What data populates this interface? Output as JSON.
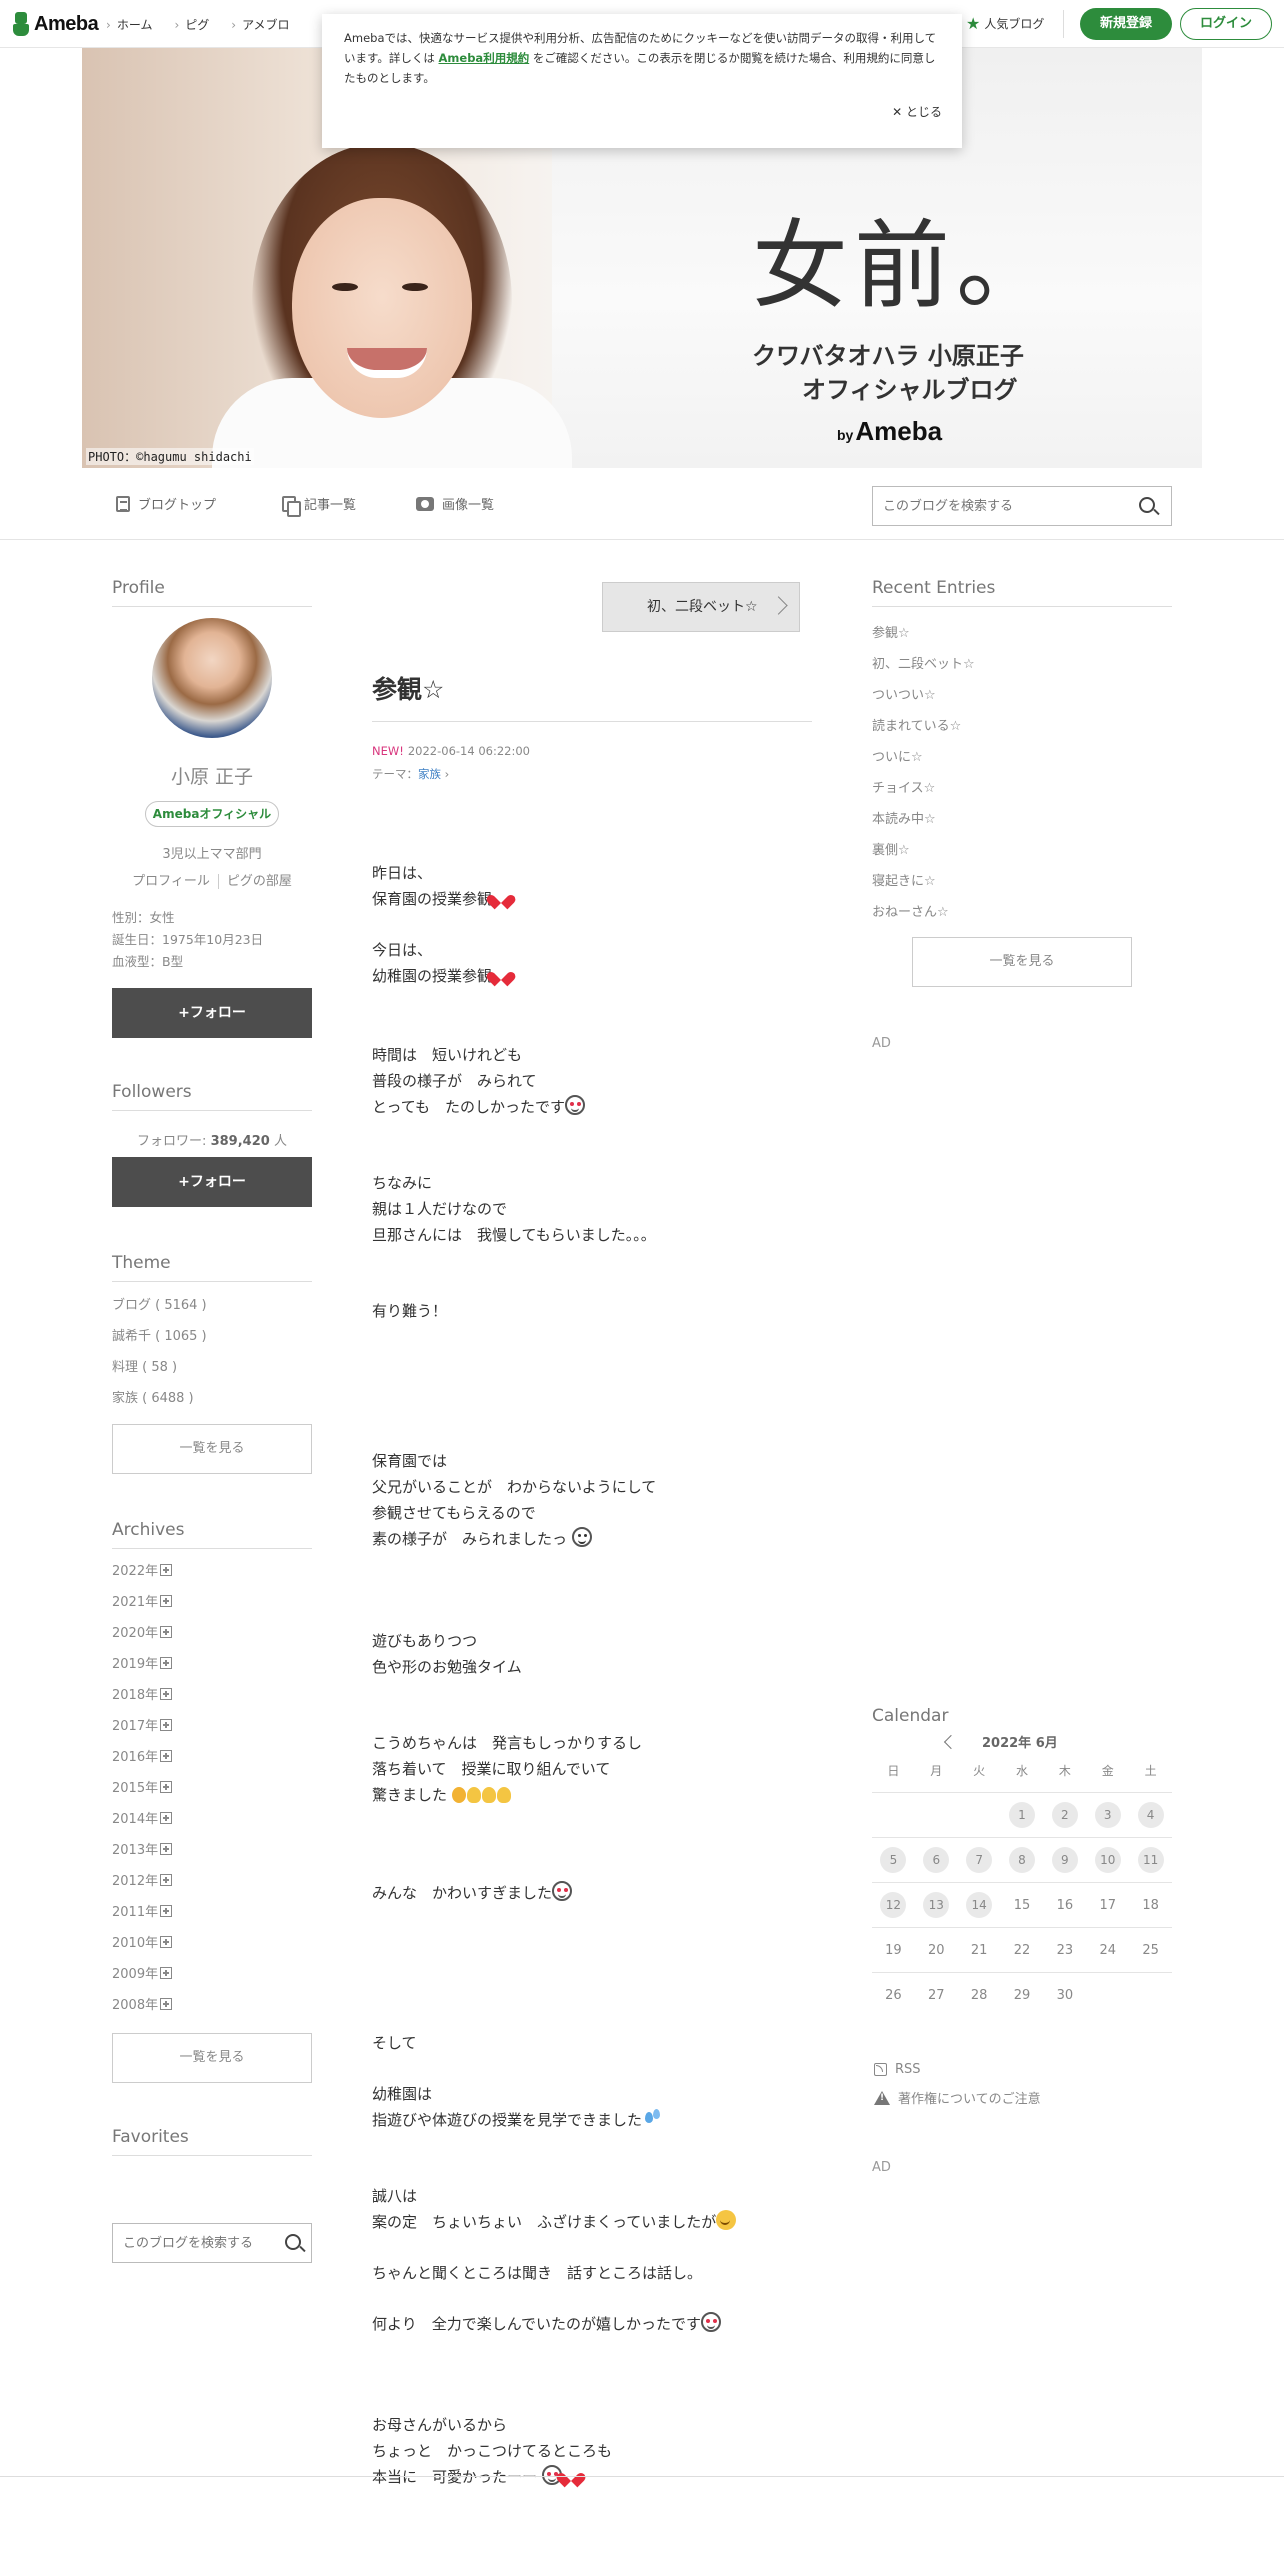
{
  "topbar": {
    "logo": "Ameba",
    "nav": [
      "ホーム",
      "ピグ",
      "アメブロ"
    ],
    "popular": "人気ブログ",
    "signup": "新規登録",
    "login": "ログイン"
  },
  "cookie": {
    "text_before": "Amebaでは、快適なサービス提供や利用分析、広告配信のためにクッキーなどを使い訪問データの取得・利用しています。詳しくは ",
    "link": "Ameba利用規約",
    "text_after": " をご確認ください。この表示を閉じるか閲覧を続けた場合、利用規約に同意したものとします。",
    "close": "✕ とじる"
  },
  "banner": {
    "title": "女前。",
    "subtitle1": "クワバタオハラ 小原正子",
    "subtitle2": "オフィシャルブログ",
    "by": "by",
    "brand": "Ameba",
    "credit": "PHOTO：©hagumu shidachi"
  },
  "blogmenu": {
    "top": "ブログトップ",
    "list": "記事一覧",
    "images": "画像一覧",
    "search_placeholder": "このブログを検索する"
  },
  "profile": {
    "section": "Profile",
    "name": "小原 正子",
    "badge": "Amebaオフィシャル",
    "category": "3児以上ママ部門",
    "link_profile": "プロフィール",
    "link_room": "ピグの部屋",
    "gender": "性別：女性",
    "birthday": "誕生日：1975年10月23日",
    "blood": "血液型：B型",
    "follow": "+フォロー"
  },
  "followers": {
    "section": "Followers",
    "label": "フォロワー:",
    "count": "389,420",
    "unit": "人",
    "follow": "+フォロー"
  },
  "theme": {
    "section": "Theme",
    "items": [
      "ブログ ( 5164 )",
      "誠希千 ( 1065 )",
      "料理 ( 58 )",
      "家族 ( 6488 )"
    ],
    "more": "一覧を見る"
  },
  "archives": {
    "section": "Archives",
    "items": [
      "2022年",
      "2021年",
      "2020年",
      "2019年",
      "2018年",
      "2017年",
      "2016年",
      "2015年",
      "2014年",
      "2013年",
      "2012年",
      "2011年",
      "2010年",
      "2009年",
      "2008年"
    ],
    "more": "一覧を見る"
  },
  "favorites": {
    "section": "Favorites",
    "search_placeholder": "このブログを検索する"
  },
  "article": {
    "prev": "初、二段ベット☆",
    "title": "参観☆",
    "new": "NEW!",
    "date": "2022-06-14 06:22:00",
    "theme_label": "テーマ：",
    "theme": "家族",
    "p1": "昨日は、\n保育園の授業参観",
    "p2": "今日は、\n幼稚園の授業参観",
    "p3": "時間は　短いけれども\n普段の様子が　みられて\nとっても　たのしかったです",
    "p4": "ちなみに\n親は１人だけなので\n旦那さんには　我慢してもらいました。。。",
    "p5": "有り難う！",
    "p6": "保育園では\n父兄がいることが　わからないようにして\n参観させてもらえるので\n素の様子が　みられましたっ",
    "p7": "遊びもありつつ\n色や形のお勉強タイム",
    "p8": "こうめちゃんは　発言もしっかりするし\n落ち着いて　授業に取り組んでいて\n驚きました",
    "p9": "みんな　かわいすぎました",
    "p10": "そして",
    "p11": "幼稚園は\n指遊びや体遊びの授業を見学できました",
    "p12": "誠八は\n案の定　ちょいちょい　ふざけまくっていましたが",
    "p13": "ちゃんと聞くところは聞き　話すところは話し。",
    "p14": "何より　全力で楽しんでいたのが嬉しかったです",
    "p15": "お母さんがいるから\nちょっと　かっこつけてるところも\n本当に　可愛かったーー"
  },
  "recent": {
    "section": "Recent Entries",
    "items": [
      "参観☆",
      "初、二段ベット☆",
      "ついつい☆",
      "読まれている☆",
      "ついに☆",
      "チョイス☆",
      "本読み中☆",
      "裏側☆",
      "寝起きに☆",
      "おねーさん☆"
    ],
    "more": "一覧を見る"
  },
  "ads": {
    "label": "AD"
  },
  "calendar": {
    "section": "Calendar",
    "month": "2022年 6月",
    "weekdays": [
      "日",
      "月",
      "火",
      "水",
      "木",
      "金",
      "土"
    ],
    "weeks": [
      [
        {
          "d": ""
        },
        {
          "d": ""
        },
        {
          "d": ""
        },
        {
          "d": "1",
          "post": true
        },
        {
          "d": "2",
          "post": true
        },
        {
          "d": "3",
          "post": true
        },
        {
          "d": "4",
          "post": true
        }
      ],
      [
        {
          "d": "5",
          "post": true
        },
        {
          "d": "6",
          "post": true
        },
        {
          "d": "7",
          "post": true
        },
        {
          "d": "8",
          "post": true
        },
        {
          "d": "9",
          "post": true
        },
        {
          "d": "10",
          "post": true
        },
        {
          "d": "11",
          "post": true
        }
      ],
      [
        {
          "d": "12",
          "post": true
        },
        {
          "d": "13",
          "post": true
        },
        {
          "d": "14",
          "post": true
        },
        {
          "d": "15"
        },
        {
          "d": "16"
        },
        {
          "d": "17"
        },
        {
          "d": "18"
        }
      ],
      [
        {
          "d": "19"
        },
        {
          "d": "20"
        },
        {
          "d": "21"
        },
        {
          "d": "22"
        },
        {
          "d": "23"
        },
        {
          "d": "24"
        },
        {
          "d": "25"
        }
      ],
      [
        {
          "d": "26"
        },
        {
          "d": "27"
        },
        {
          "d": "28"
        },
        {
          "d": "29"
        },
        {
          "d": "30"
        },
        {
          "d": ""
        },
        {
          "d": ""
        }
      ]
    ]
  },
  "links": {
    "rss": "RSS",
    "copyright": "著作権についてのご注意"
  },
  "colors": {
    "brand_green": "#2d8c3c",
    "follow_button": "#4d4d4d",
    "new_badge": "#d8357d",
    "theme_link": "#3d7fc4"
  }
}
